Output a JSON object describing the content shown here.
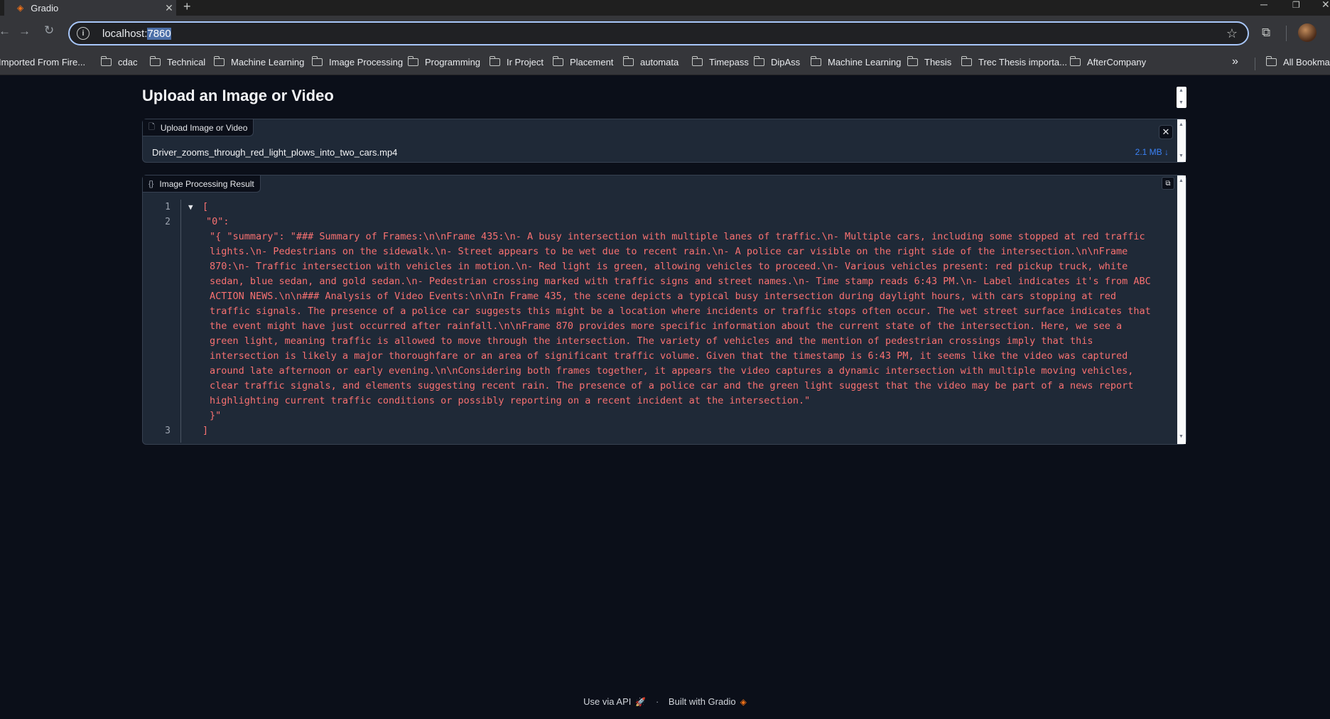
{
  "browser": {
    "tab_title": "Gradio",
    "url_host": "localhost:",
    "url_port": "7860",
    "bookmarks": [
      "Imported From Fire...",
      "cdac",
      "Technical",
      "Machine Learning",
      "Image Processing",
      "Programming",
      "Ir Project",
      "Placement",
      "automata",
      "Timepass",
      "DipAss",
      "Machine Learning",
      "Thesis",
      "Trec Thesis importa...",
      "AfterCompany"
    ],
    "all_bookmarks": "All Bookmar"
  },
  "page": {
    "title": "Upload an Image or Video"
  },
  "upload": {
    "label": "Upload Image or Video",
    "file_name": "Driver_zooms_through_red_light_plows_into_two_cars.mp4",
    "file_size": "2.1 MB ↓"
  },
  "result": {
    "label": "Image Processing Result",
    "line_numbers": [
      "1",
      "2",
      "3"
    ],
    "open_bracket": "[",
    "key": "\"0\":",
    "summary_value": "\"{ \"summary\": \"### Summary of Frames:\\n\\nFrame 435:\\n- A busy intersection with multiple lanes of traffic.\\n- Multiple cars, including some stopped at red traffic lights.\\n- Pedestrians on the sidewalk.\\n- Street appears to be wet due to recent rain.\\n- A police car visible on the right side of the intersection.\\n\\nFrame 870:\\n- Traffic intersection with vehicles in motion.\\n- Red light is green, allowing vehicles to proceed.\\n- Various vehicles present: red pickup truck, white sedan, blue sedan, and gold sedan.\\n- Pedestrian crossing marked with traffic signs and street names.\\n- Time stamp reads 6:43 PM.\\n- Label indicates it's from ABC ACTION NEWS.\\n\\n### Analysis of Video Events:\\n\\nIn Frame 435, the scene depicts a typical busy intersection during daylight hours, with cars stopping at red traffic signals. The presence of a police car suggests this might be a location where incidents or traffic stops often occur. The wet street surface indicates that the event might have just occurred after rainfall.\\n\\nFrame 870 provides more specific information about the current state of the intersection. Here, we see a green light, meaning traffic is allowed to move through the intersection. The variety of vehicles and the mention of pedestrian crossings imply that this intersection is likely a major thoroughfare or an area of significant traffic volume. Given that the timestamp is 6:43 PM, it seems like the video was captured around late afternoon or early evening.\\n\\nConsidering both frames together, it appears the video captures a dynamic intersection with multiple moving vehicles, clear traffic signals, and elements suggesting recent rain. The presence of a police car and the green light suggest that the video may be part of a news report highlighting current traffic conditions or possibly reporting on a recent incident at the intersection.\"",
    "closing_brace": "}\"",
    "close_bracket": "]"
  },
  "footer": {
    "api_label": "Use via API",
    "separator": "·",
    "built_label": "Built with Gradio"
  },
  "colors": {
    "accent": "#f97316",
    "json_string": "#f87171",
    "link": "#3b82f6",
    "background": "#0b0f19"
  }
}
